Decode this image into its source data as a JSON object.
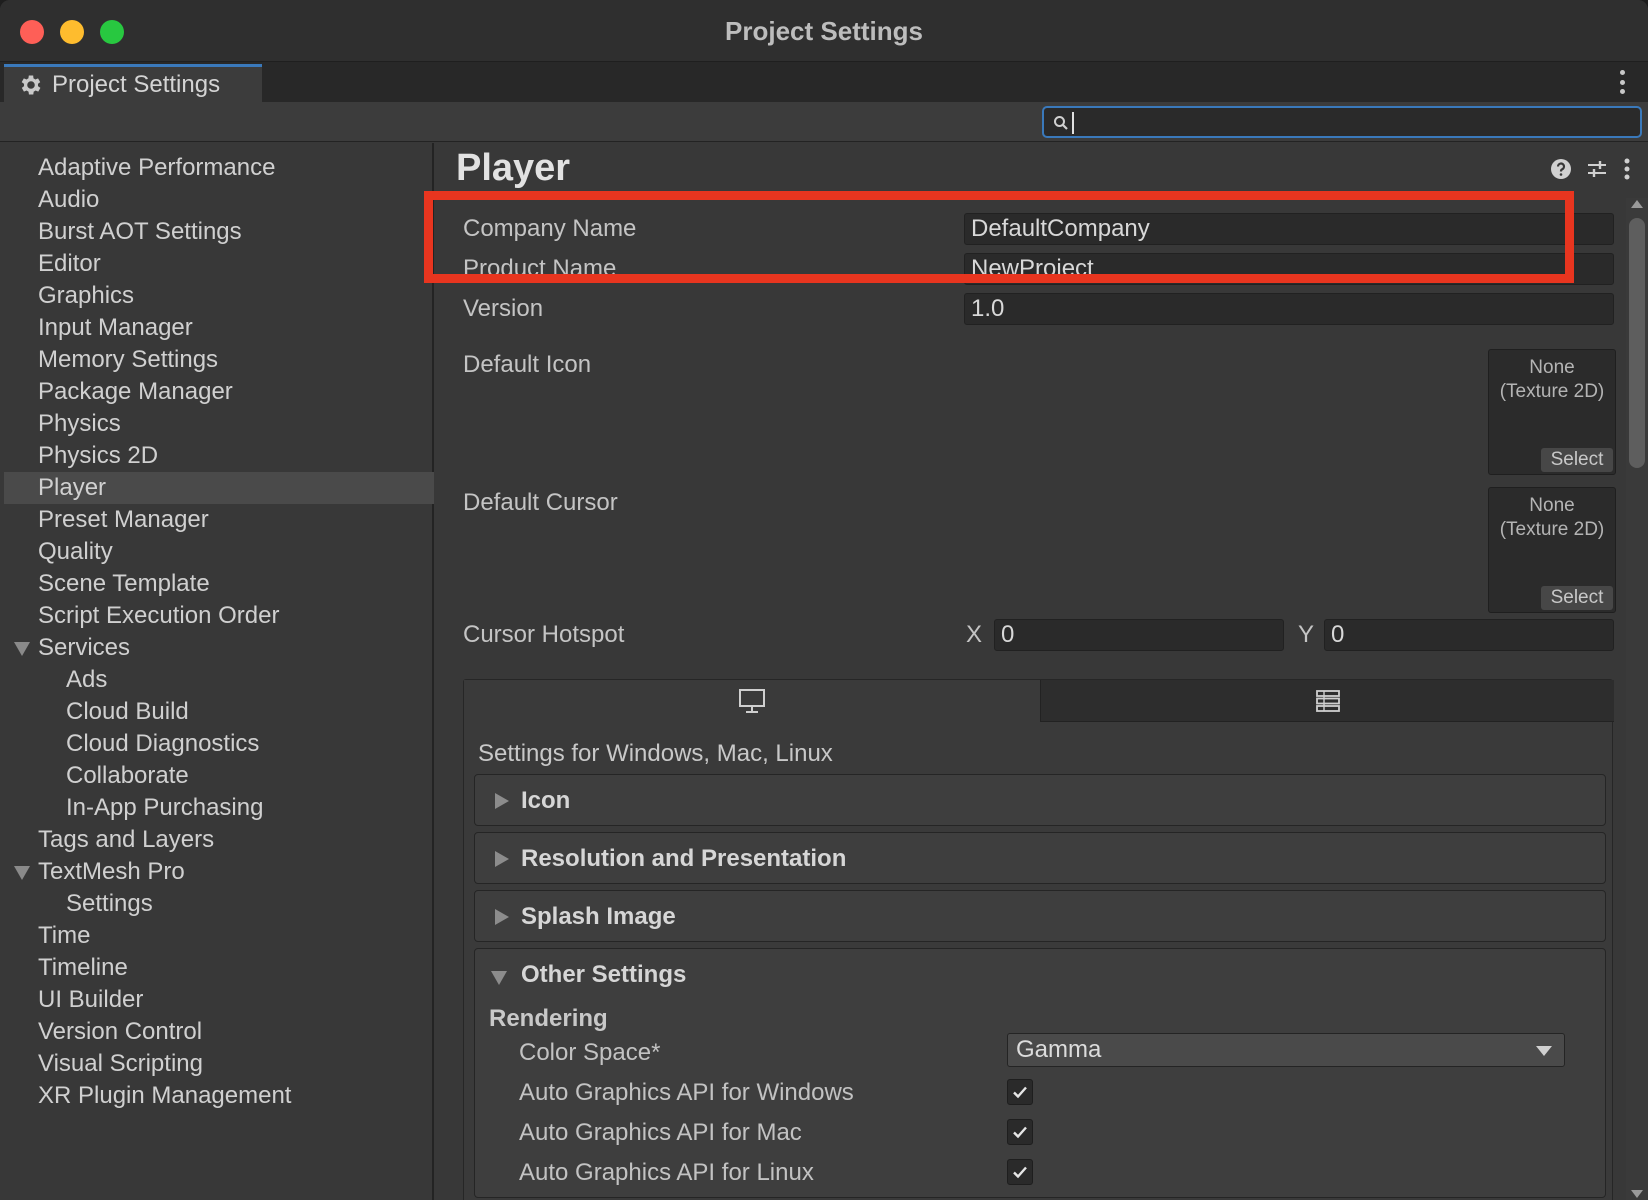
{
  "window": {
    "title": "Project Settings"
  },
  "tab": {
    "label": "Project Settings",
    "icon": "gear-icon"
  },
  "search": {
    "value": "",
    "placeholder": ""
  },
  "sidebar": {
    "items": [
      {
        "label": "Adaptive Performance",
        "level": 0
      },
      {
        "label": "Audio",
        "level": 0
      },
      {
        "label": "Burst AOT Settings",
        "level": 0
      },
      {
        "label": "Editor",
        "level": 0
      },
      {
        "label": "Graphics",
        "level": 0
      },
      {
        "label": "Input Manager",
        "level": 0
      },
      {
        "label": "Memory Settings",
        "level": 0
      },
      {
        "label": "Package Manager",
        "level": 0
      },
      {
        "label": "Physics",
        "level": 0
      },
      {
        "label": "Physics 2D",
        "level": 0
      },
      {
        "label": "Player",
        "level": 0,
        "selected": true
      },
      {
        "label": "Preset Manager",
        "level": 0
      },
      {
        "label": "Quality",
        "level": 0
      },
      {
        "label": "Scene Template",
        "level": 0
      },
      {
        "label": "Script Execution Order",
        "level": 0
      },
      {
        "label": "Services",
        "level": 0,
        "expanded": true
      },
      {
        "label": "Ads",
        "level": 1
      },
      {
        "label": "Cloud Build",
        "level": 1
      },
      {
        "label": "Cloud Diagnostics",
        "level": 1
      },
      {
        "label": "Collaborate",
        "level": 1
      },
      {
        "label": "In-App Purchasing",
        "level": 1
      },
      {
        "label": "Tags and Layers",
        "level": 0
      },
      {
        "label": "TextMesh Pro",
        "level": 0,
        "expanded": true
      },
      {
        "label": "Settings",
        "level": 1
      },
      {
        "label": "Time",
        "level": 0
      },
      {
        "label": "Timeline",
        "level": 0
      },
      {
        "label": "UI Builder",
        "level": 0
      },
      {
        "label": "Version Control",
        "level": 0
      },
      {
        "label": "Visual Scripting",
        "level": 0
      },
      {
        "label": "XR Plugin Management",
        "level": 0
      }
    ]
  },
  "main": {
    "title": "Player",
    "header_icons": [
      "help-icon",
      "preset-sliders-icon",
      "more-options-icon"
    ],
    "fields": {
      "company_name": {
        "label": "Company Name",
        "value": "DefaultCompany"
      },
      "product_name": {
        "label": "Product Name",
        "value": "NewProject"
      },
      "version": {
        "label": "Version",
        "value": "1.0"
      },
      "default_icon": {
        "label": "Default Icon",
        "value_line1": "None",
        "value_line2": "(Texture 2D)",
        "select": "Select"
      },
      "default_cursor": {
        "label": "Default Cursor",
        "value_line1": "None",
        "value_line2": "(Texture 2D)",
        "select": "Select"
      },
      "cursor_hotspot": {
        "label": "Cursor Hotspot",
        "x_label": "X",
        "x_value": "0",
        "y_label": "Y",
        "y_value": "0"
      }
    },
    "highlight_color": "#e8351f",
    "platform": {
      "tabs": [
        "desktop-monitor-icon",
        "dedicated-server-icon"
      ],
      "caption": "Settings for Windows, Mac, Linux",
      "foldouts": [
        "Icon",
        "Resolution and Presentation",
        "Splash Image"
      ],
      "other_settings": {
        "title": "Other Settings",
        "section": "Rendering",
        "color_space": {
          "label": "Color Space*",
          "value": "Gamma"
        },
        "checks": [
          {
            "label": "Auto Graphics API  for Windows",
            "checked": true
          },
          {
            "label": "Auto Graphics API  for Mac",
            "checked": true
          },
          {
            "label": "Auto Graphics API  for Linux",
            "checked": true
          }
        ]
      }
    }
  }
}
